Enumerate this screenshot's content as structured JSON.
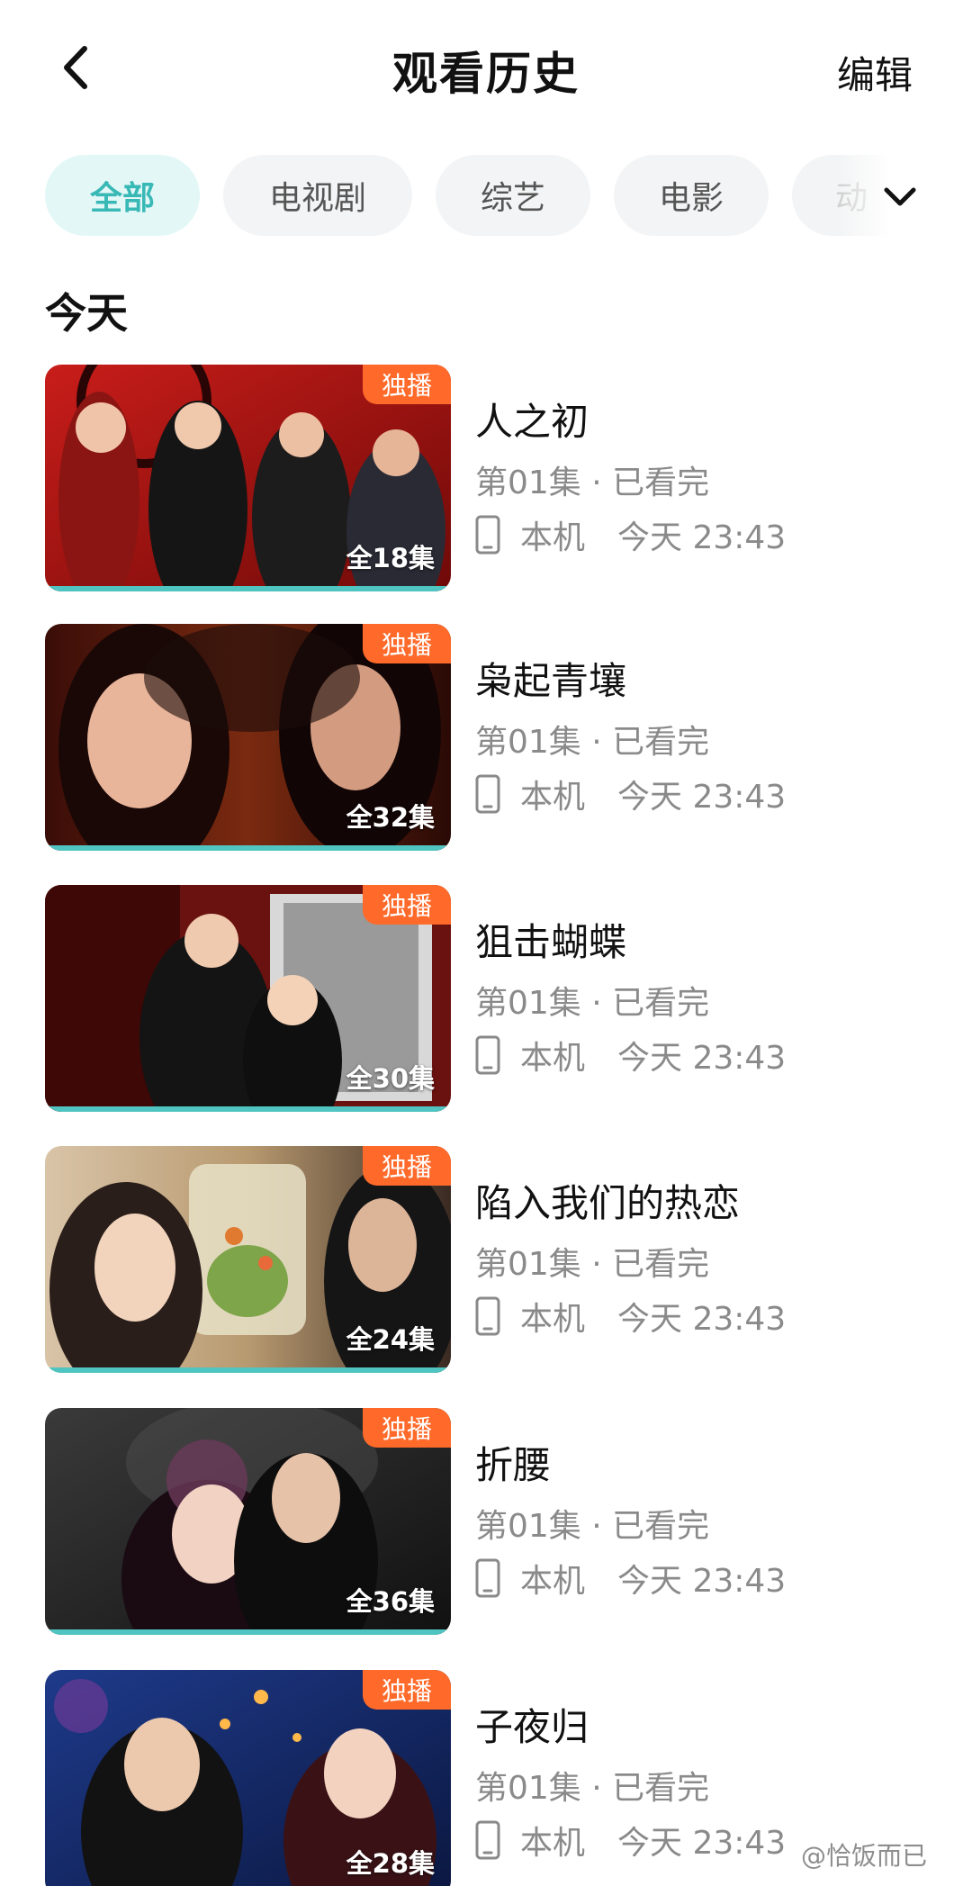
{
  "header": {
    "title": "观看历史",
    "edit_label": "编辑",
    "back_icon": "chevron-left-icon"
  },
  "filters": {
    "chips": [
      "全部",
      "电视剧",
      "综艺",
      "电影",
      "动"
    ],
    "active_index": 0,
    "expand_icon": "chevron-down-icon"
  },
  "section": {
    "title": "今天"
  },
  "items": [
    {
      "title": "人之初",
      "badge": "独播",
      "episodes": "全18集",
      "progress_text": "第01集 · 已看完",
      "device": "本机",
      "time": "今天 23:43",
      "device_icon": "phone-icon"
    },
    {
      "title": "枭起青壤",
      "badge": "独播",
      "episodes": "全32集",
      "progress_text": "第01集 · 已看完",
      "device": "本机",
      "time": "今天 23:43",
      "device_icon": "phone-icon"
    },
    {
      "title": "狙击蝴蝶",
      "badge": "独播",
      "episodes": "全30集",
      "progress_text": "第01集 · 已看完",
      "device": "本机",
      "time": "今天 23:43",
      "device_icon": "phone-icon"
    },
    {
      "title": "陷入我们的热恋",
      "badge": "独播",
      "episodes": "全24集",
      "progress_text": "第01集 · 已看完",
      "device": "本机",
      "time": "今天 23:43",
      "device_icon": "phone-icon"
    },
    {
      "title": "折腰",
      "badge": "独播",
      "episodes": "全36集",
      "progress_text": "第01集 · 已看完",
      "device": "本机",
      "time": "今天 23:43",
      "device_icon": "phone-icon"
    },
    {
      "title": "子夜归",
      "badge": "独播",
      "episodes": "全28集",
      "progress_text": "第01集 · 已看完",
      "device": "本机",
      "time": "今天 23:43",
      "device_icon": "phone-icon"
    }
  ],
  "colors": {
    "accent": "#38b9b6",
    "badge": "#ff6a2a",
    "progress_bar": "#4fc4c1",
    "secondary_text": "#8a8a8a"
  },
  "watermark": "@恰饭而已"
}
